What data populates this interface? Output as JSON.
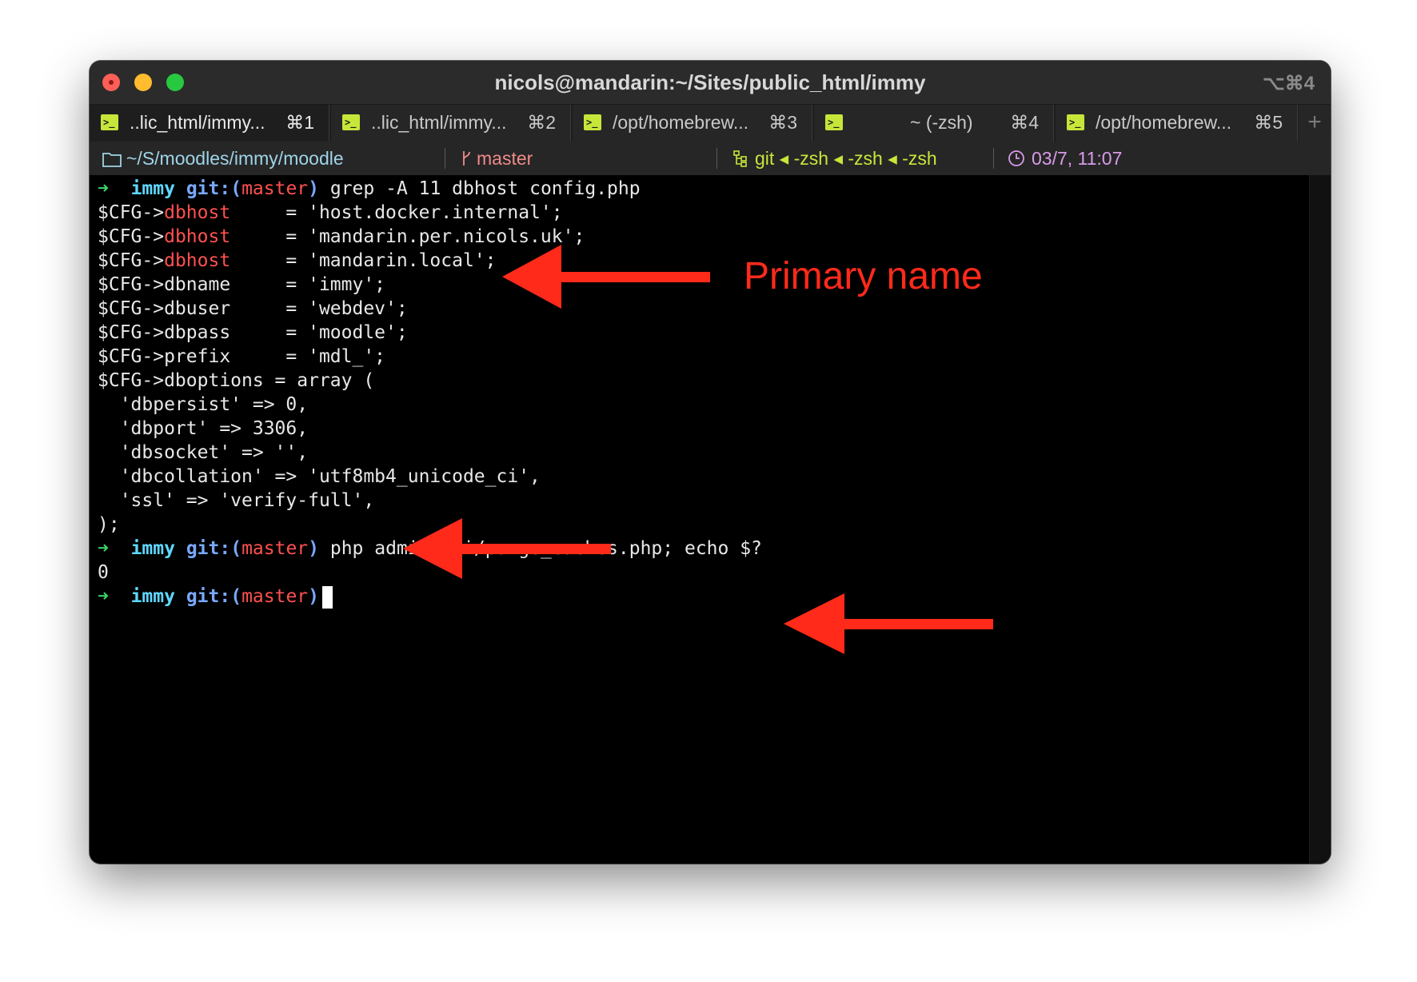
{
  "window": {
    "title": "nicols@mandarin:~/Sites/public_html/immy",
    "shortcut": "⌥⌘4"
  },
  "tabs": [
    {
      "label": "..lic_html/immy...",
      "key": "⌘1"
    },
    {
      "label": "..lic_html/immy...",
      "key": "⌘2"
    },
    {
      "label": "/opt/homebrew...",
      "key": "⌘3"
    },
    {
      "label": "~ (-zsh)",
      "key": "⌘4"
    },
    {
      "label": "/opt/homebrew...",
      "key": "⌘5"
    }
  ],
  "new_tab_label": "+",
  "status": {
    "path": "~/S/moodles/immy/moodle",
    "branch": "master",
    "processes": "git ◂ -zsh ◂ -zsh ◂ -zsh",
    "datetime": "03/7, 11:07"
  },
  "terminal": {
    "prompt_arrow": "➜",
    "prompt_dir": "immy",
    "prompt_git": "git:(",
    "prompt_branch": "master",
    "prompt_close": ")",
    "cmd1": " grep -A 11 dbhost config.php",
    "cfg_prefix": "$CFG->",
    "dbhost_key": "dbhost",
    "dbhost1_val": "     = 'host.docker.internal';",
    "dbhost2_val": "     = 'mandarin.per.nicols.uk';",
    "dbhost3_val": "     = 'mandarin.local';",
    "dbname_line": "$CFG->dbname     = 'immy';",
    "dbuser_line": "$CFG->dbuser     = 'webdev';",
    "dbpass_line": "$CFG->dbpass     = 'moodle';",
    "prefix_line": "$CFG->prefix     = 'mdl_';",
    "dboptions_line": "$CFG->dboptions = array (",
    "opt1": "  'dbpersist' => 0,",
    "opt2": "  'dbport' => 3306,",
    "opt3": "  'dbsocket' => '',",
    "opt4": "  'dbcollation' => 'utf8mb4_unicode_ci',",
    "opt5": "  'ssl' => 'verify-full',",
    "close_line": ");",
    "cmd2": " php admin/cli/purge_caches.php; echo $?",
    "exit_code": "0"
  },
  "annotation": {
    "text": "Primary name",
    "color": "#ff2a1a"
  }
}
